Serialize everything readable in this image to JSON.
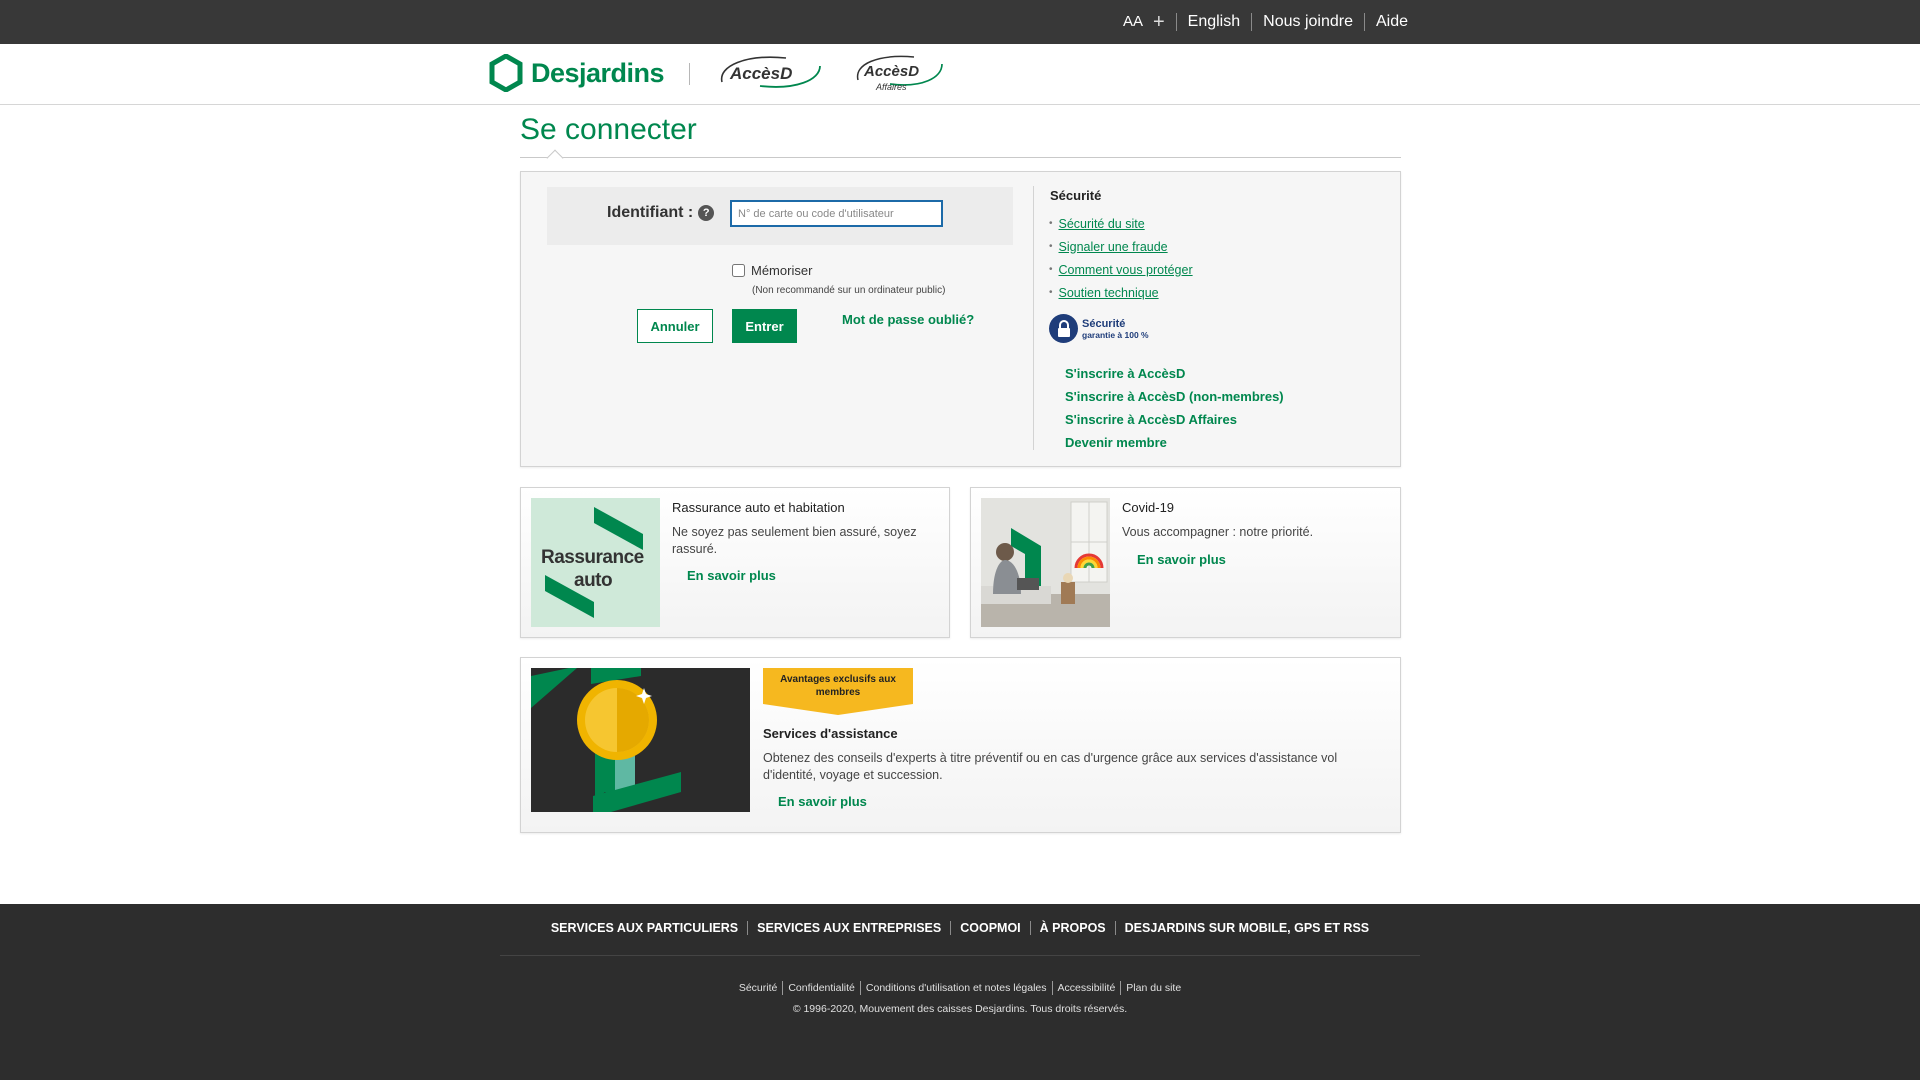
{
  "topbar": {
    "font_size": "AA",
    "font_plus": "+",
    "links": [
      "English",
      "Nous joindre",
      "Aide"
    ]
  },
  "header": {
    "logo_text": "Desjardins",
    "accesd_logo": "AccèsD",
    "accesd_affaires_logo": "AccèsD",
    "accesd_affaires_sub": "Affaires"
  },
  "page": {
    "title": "Se connecter"
  },
  "login": {
    "identifier_label": "Identifiant :",
    "identifier_placeholder": "N° de carte ou code d'utilisateur",
    "remember_label": "Mémoriser",
    "remember_note": "(Non recommandé sur un ordinateur public)",
    "cancel_label": "Annuler",
    "submit_label": "Entrer",
    "forgot_label": "Mot de passe oublié?"
  },
  "security": {
    "title": "Sécurité",
    "links": [
      "Sécurité du site",
      "Signaler une fraude",
      "Comment vous protéger",
      "Soutien technique"
    ],
    "badge_line1": "Sécurité",
    "badge_line2": "garantie à 100 %",
    "enroll_links": [
      "S'inscrire à AccèsD",
      "S'inscrire à AccèsD (non-membres)",
      "S'inscrire à AccèsD Affaires",
      "Devenir membre"
    ]
  },
  "promos": [
    {
      "title": "Rassurance auto et habitation",
      "description": "Ne soyez pas seulement bien assuré, soyez rassuré.",
      "link": "En savoir plus",
      "image_line1": "Rassurance",
      "image_line2": "auto"
    },
    {
      "title": "Covid-19",
      "description": "Vous accompagner : notre priorité.",
      "link": "En savoir plus"
    }
  ],
  "feature": {
    "tag": "Avantages exclusifs aux membres",
    "title": "Services d'assistance",
    "description": "Obtenez des conseils d'experts à titre préventif ou en cas d'urgence grâce aux services d'assistance vol d'identité, voyage et succession.",
    "link": "En savoir plus"
  },
  "footer": {
    "nav": [
      "SERVICES AUX PARTICULIERS",
      "SERVICES AUX ENTREPRISES",
      "COOPMOI",
      "À PROPOS",
      "DESJARDINS SUR MOBILE, GPS ET RSS"
    ],
    "legal": [
      "Sécurité",
      "Confidentialité",
      "Conditions d'utilisation et notes légales",
      "Accessibilité",
      "Plan du site"
    ],
    "copyright": "© 1996-2020, Mouvement des caisses Desjardins. Tous droits réservés."
  },
  "colors": {
    "brand_green": "#00874e",
    "topbar_bg": "#383838",
    "footer_bg": "#2d2d2d",
    "input_border": "#1c6aa8",
    "badge_blue": "#1f3d7a",
    "tag_yellow": "#f6b81f"
  }
}
